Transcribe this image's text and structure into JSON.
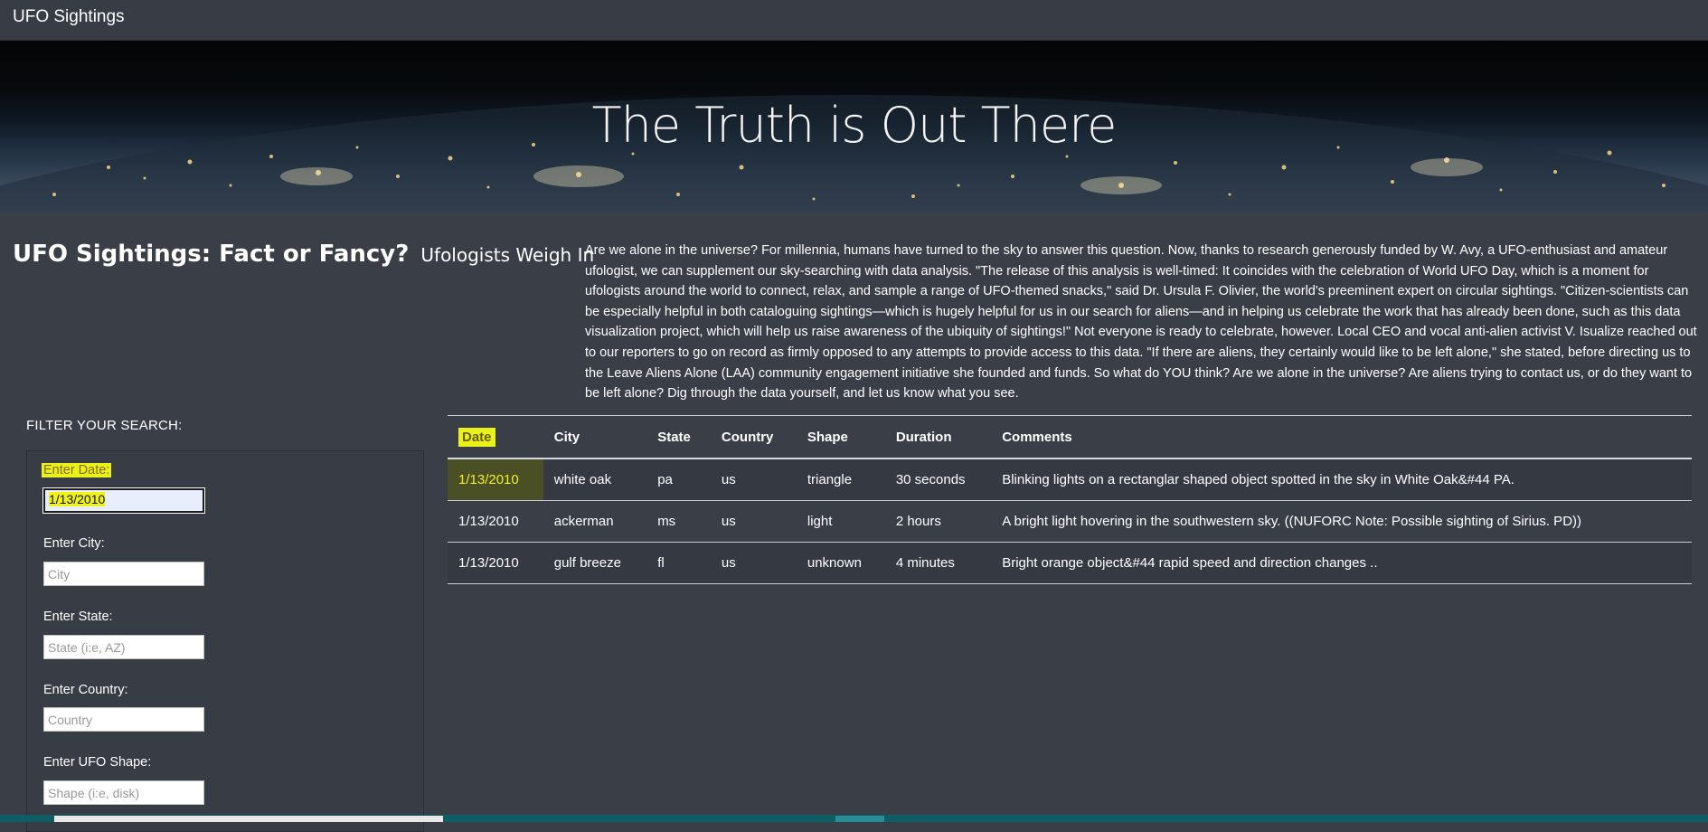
{
  "navbar": {
    "brand": "UFO Sightings"
  },
  "hero": {
    "title": "The Truth is Out There"
  },
  "article": {
    "title": "UFO Sightings: Fact or Fancy?",
    "subtitle": "Ufologists Weigh In",
    "body": "Are we alone in the universe? For millennia, humans have turned to the sky to answer this question. Now, thanks to research generously funded by W. Avy, a UFO-enthusiast and amateur ufologist, we can supplement our sky-searching with data analysis. \"The release of this analysis is well-timed: It coincides with the celebration of World UFO Day, which is a moment for ufologists around the world to connect, relax, and sample a range of UFO-themed snacks,\" said Dr. Ursula F. Olivier, the world's preeminent expert on circular sightings. \"Citizen-scientists can be especially helpful in both cataloguing sightings—which is hugely helpful for us in our search for aliens—and in helping us celebrate the work that has already been done, such as this data visualization project, which will help us raise awareness of the ubiquity of sightings!\" Not everyone is ready to celebrate, however. Local CEO and vocal anti-alien activist V. Isualize reached out to our reporters to go on record as firmly opposed to any attempts to provide access to this data. \"If there are aliens, they certainly would like to be left alone,\" she stated, before directing us to the Leave Aliens Alone (LAA) community engagement initiative she founded and funds. So what do YOU think? Are we alone in the universe? Are aliens trying to contact us, or do they want to be left alone? Dig through the data yourself, and let us know what you see."
  },
  "filters": {
    "heading": "FILTER YOUR SEARCH:",
    "date": {
      "label": "Enter Date:",
      "value": "1/13/2010"
    },
    "city": {
      "label": "Enter City:",
      "placeholder": "City"
    },
    "state": {
      "label": "Enter State:",
      "placeholder": "State (i:e, AZ)"
    },
    "country": {
      "label": "Enter Country:",
      "placeholder": "Country"
    },
    "shape": {
      "label": "Enter UFO Shape:",
      "placeholder": "Shape (i:e, disk)"
    }
  },
  "table": {
    "headers": [
      "Date",
      "City",
      "State",
      "Country",
      "Shape",
      "Duration",
      "Comments"
    ],
    "rows": [
      [
        "1/13/2010",
        "white oak",
        "pa",
        "us",
        "triangle",
        "30 seconds",
        "Blinking lights on a rectanglar shaped object spotted in the sky in White Oak&#44 PA."
      ],
      [
        "1/13/2010",
        "ackerman",
        "ms",
        "us",
        "light",
        "2 hours",
        "A bright light hovering in the southwestern sky. ((NUFORC Note: Possible sighting of Sirius. PD))"
      ],
      [
        "1/13/2010",
        "gulf breeze",
        "fl",
        "us",
        "unknown",
        "4 minutes",
        "Bright orange object&#44 rapid speed and direction changes .."
      ]
    ]
  },
  "colors": {
    "background": "#3a3f47",
    "highlight": "#e9f21a",
    "taskbar": "#0d5e65"
  }
}
